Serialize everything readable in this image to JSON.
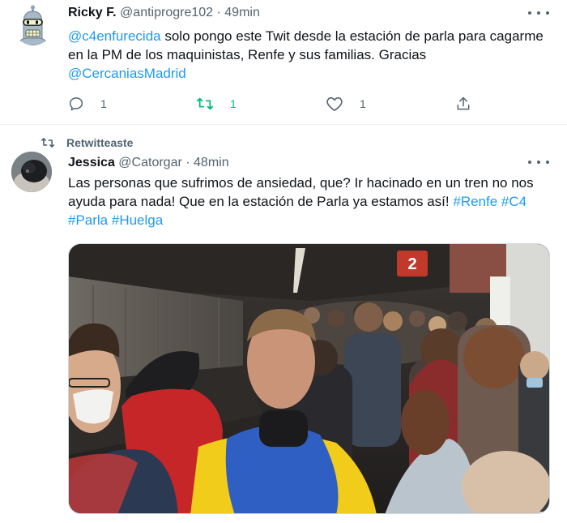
{
  "tweets": [
    {
      "name": "Ricky F.",
      "handle": "@antiprogre102",
      "dot": "·",
      "time": "49min",
      "text": {
        "mention": "@c4enfurecida",
        "body": " solo pongo este Twit desde la estación de parla para cagarme en la PM de los maquinistas, Renfe y sus familias. Gracias ",
        "mention2": "@CercaniasMadrid"
      },
      "counts": {
        "replies": "1",
        "retweets": "1",
        "likes": "1"
      },
      "colors": {
        "retweet_active": "#00ba7c"
      }
    },
    {
      "retweet_label": "Retwitteaste",
      "name": "Jessica",
      "handle": "@Catorgar",
      "dot": "·",
      "time": "48min",
      "text": {
        "body": "Las personas que sufrimos de ansiedad, que? Ir hacinado en un tren no nos ayuda para nada! Que en la estación de Parla ya estamos así! ",
        "tags": [
          "#Renfe",
          "#C4",
          "#Parla",
          "#Huelga"
        ]
      },
      "media": {
        "description": "",
        "sign_number": "2"
      }
    }
  ],
  "colors": {
    "link": "#1d9bf0",
    "secondary": "#536471",
    "divider": "#eff3f4"
  },
  "icons": [
    "bender-avatar-icon",
    "more-icon",
    "reply-icon",
    "retweet-icon",
    "like-icon",
    "share-icon"
  ]
}
